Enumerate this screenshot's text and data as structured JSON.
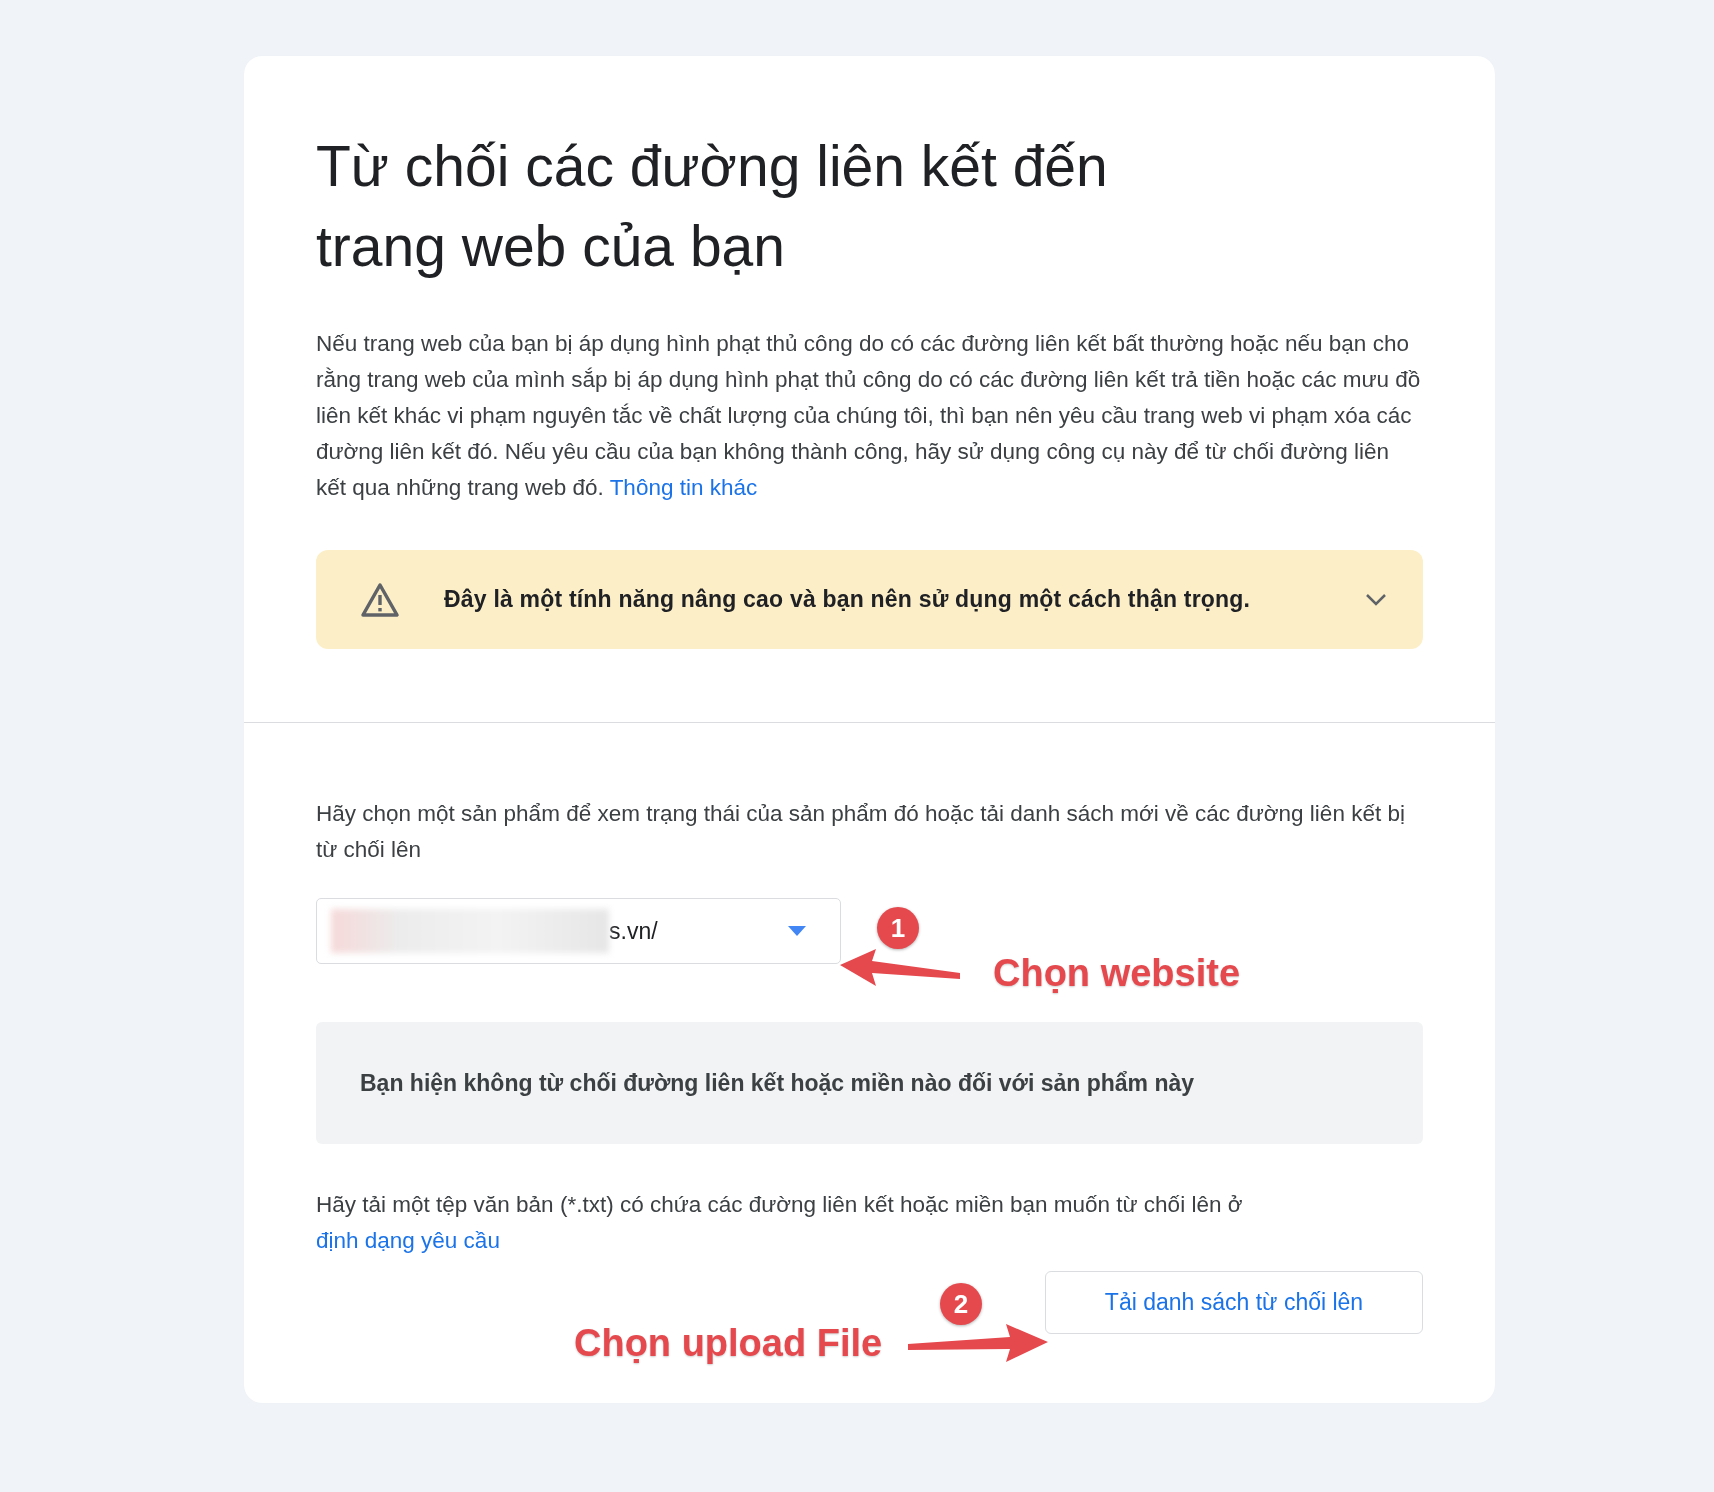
{
  "heading": "Từ chối các đường liên kết đến trang web của bạn",
  "intro": {
    "text": "Nếu trang web của bạn bị áp dụng hình phạt thủ công do có các đường liên kết bất thường hoặc nếu bạn cho rằng trang web của mình sắp bị áp dụng hình phạt thủ công do có các đường liên kết trả tiền hoặc các mưu đồ liên kết khác vi phạm nguyên tắc về chất lượng của chúng tôi, thì bạn nên yêu cầu trang web vi phạm xóa các đường liên kết đó. Nếu yêu cầu của bạn không thành công, hãy sử dụng công cụ này để từ chối đường liên kết qua những trang web đó.",
    "link": "Thông tin khác"
  },
  "warning": {
    "text": "Đây là một tính năng nâng cao và bạn nên sử dụng một cách thận trọng.",
    "expanded": false
  },
  "product_prompt": "Hãy chọn một sản phẩm để xem trạng thái của sản phẩm đó hoặc tải danh sách mới về các đường liên kết bị từ chối lên",
  "product_select": {
    "value": "s.vn/"
  },
  "status_message": "Bạn hiện không từ chối đường liên kết hoặc miền nào đối với sản phẩm này",
  "upload_hint": {
    "text": "Hãy tải một tệp văn bản (*.txt) có chứa các đường liên kết hoặc miền bạn muốn từ chối lên ở",
    "link": "định dạng yêu cầu"
  },
  "upload_button": "Tải danh sách từ chối lên",
  "annotations": [
    {
      "number": "1",
      "label": "Chọn website"
    },
    {
      "number": "2",
      "label": "Chọn upload File"
    }
  ]
}
